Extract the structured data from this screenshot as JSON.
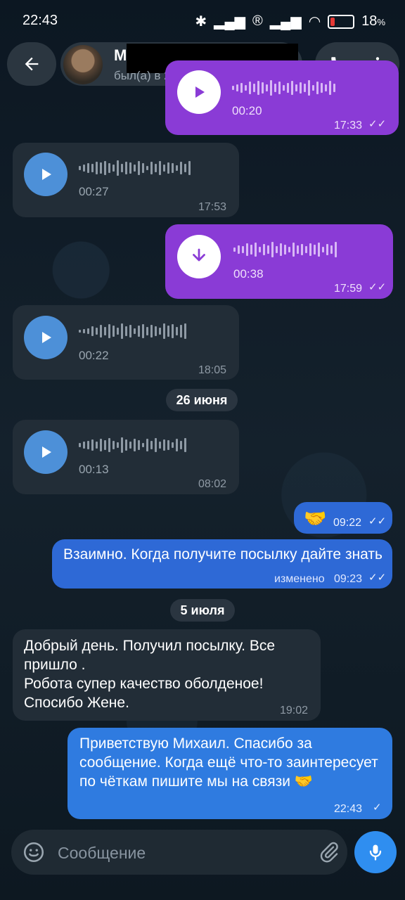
{
  "status": {
    "time": "22:43",
    "battery": "18",
    "battery_unit": "%"
  },
  "header": {
    "contact_initial": "М",
    "last_seen": "был(а) в 22:34",
    "back_icon": "arrow-left-icon",
    "call_icon": "phone-icon",
    "more_icon": "more-vert-icon"
  },
  "messages": [
    {
      "type": "voice",
      "direction": "out",
      "duration": "00:20",
      "time": "17:33",
      "status": "read"
    },
    {
      "type": "voice",
      "direction": "in",
      "duration": "00:27",
      "time": "17:53"
    },
    {
      "type": "voice",
      "direction": "out",
      "duration": "00:38",
      "time": "17:59",
      "status": "read",
      "download": true
    },
    {
      "type": "voice",
      "direction": "in",
      "duration": "00:22",
      "time": "18:05"
    },
    {
      "type": "date",
      "label": "26 июня"
    },
    {
      "type": "voice",
      "direction": "in",
      "duration": "00:13",
      "time": "08:02"
    },
    {
      "type": "emoji",
      "direction": "out",
      "emoji": "🤝",
      "time": "09:22",
      "status": "read"
    },
    {
      "type": "text",
      "direction": "out",
      "text": "Взаимно. Когда получите посылку дайте знать",
      "edited_label": "изменено",
      "time": "09:23",
      "status": "read"
    },
    {
      "type": "date",
      "label": "5 июля"
    },
    {
      "type": "text",
      "direction": "in",
      "text": "Добрый день. Получил посылку. Все пришло .\nРобота супер качество оболденое!\nСпосибо Жене.",
      "time": "19:02"
    },
    {
      "type": "text",
      "direction": "out",
      "text": "Приветствую Михаил.  Спасибо за сообщение. Когда ещё что-то заинтересует по чёткам пишите мы на связи 🤝",
      "time": "22:43",
      "status": "sent"
    }
  ],
  "input": {
    "placeholder": "Сообщение"
  },
  "colors": {
    "out_purple": "#8a3bd6",
    "out_blue": "#2e69d6",
    "in_bubble": "#222d37",
    "play_blue": "#4d90d8",
    "mic_blue": "#2f8ef0"
  }
}
